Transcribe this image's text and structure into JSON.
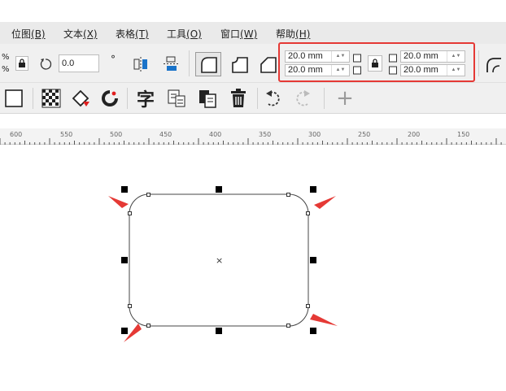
{
  "menu": [
    {
      "label": "位图",
      "key": "(B)"
    },
    {
      "label": "文本",
      "key": "(X)"
    },
    {
      "label": "表格",
      "key": "(T)"
    },
    {
      "label": "工具",
      "key": "(O)"
    },
    {
      "label": "窗口",
      "key": "(W)"
    },
    {
      "label": "帮助",
      "key": "(H)"
    }
  ],
  "toolbar": {
    "percent_a": "%",
    "percent_b": "%",
    "rotation_value": "0.0",
    "degree_symbol": "°",
    "corner_top_left": "20.0 mm",
    "corner_bottom_left": "20.0 mm",
    "corner_top_right": "20.0 mm",
    "corner_bottom_right": "20.0 mm",
    "char_glyph": "字",
    "add_glyph": "+"
  },
  "ruler": {
    "labels": [
      "600",
      "550",
      "500",
      "450",
      "400",
      "350",
      "300",
      "250",
      "200",
      "150"
    ]
  },
  "canvas": {
    "center_mark": "×"
  },
  "colors": {
    "highlight": "#e53935",
    "arrow": "#e53935",
    "menubar": "#eaeaea",
    "toolbar": "#f0f0f0"
  }
}
